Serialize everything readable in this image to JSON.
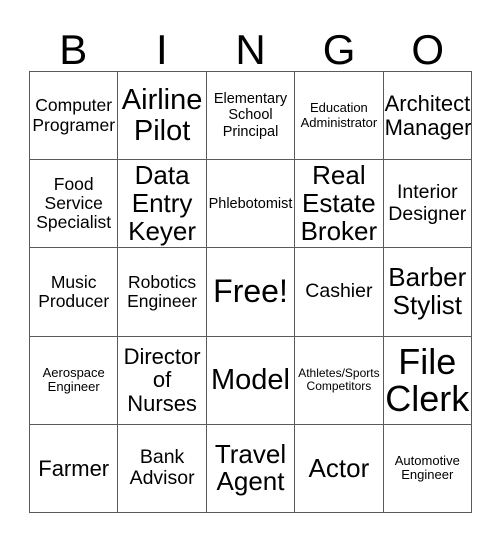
{
  "card": {
    "title": "BINGO",
    "header_letters": [
      "B",
      "I",
      "N",
      "G",
      "O"
    ],
    "columns": 5,
    "rows": 5,
    "free_space_label": "Free!",
    "free_space_position": {
      "row": 3,
      "column": 3
    },
    "colors": {
      "background": "#ffffff",
      "text": "#000000",
      "grid_line": "#5a5a5a"
    },
    "rows_data": [
      {
        "index": 1,
        "cells": [
          {
            "column": "B",
            "label": "Computer\nProgramer",
            "size": "fs-m"
          },
          {
            "column": "I",
            "label": "Airline\nPilot",
            "size": "fs-xxl"
          },
          {
            "column": "N",
            "label": "Elementary\nSchool\nPrincipal",
            "size": "fs-s"
          },
          {
            "column": "G",
            "label": "Education\nAdministrator",
            "size": "fs-xs"
          },
          {
            "column": "O",
            "label": "Architect\nManager",
            "size": "fs-l"
          }
        ]
      },
      {
        "index": 2,
        "cells": [
          {
            "column": "B",
            "label": "Food\nService\nSpecialist",
            "size": "fs-m"
          },
          {
            "column": "I",
            "label": "Data\nEntry\nKeyer",
            "size": "fs-xl"
          },
          {
            "column": "N",
            "label": "Phlebotomist",
            "size": "fs-s"
          },
          {
            "column": "G",
            "label": "Real\nEstate\nBroker",
            "size": "fs-xl"
          },
          {
            "column": "O",
            "label": "Interior\nDesigner",
            "size": "fs-ml"
          }
        ]
      },
      {
        "index": 3,
        "cells": [
          {
            "column": "B",
            "label": "Music\nProducer",
            "size": "fs-m"
          },
          {
            "column": "I",
            "label": "Robotics\nEngineer",
            "size": "fs-m"
          },
          {
            "column": "N",
            "label": "Free!",
            "size": "fs-3xl"
          },
          {
            "column": "G",
            "label": "Cashier",
            "size": "fs-ml"
          },
          {
            "column": "O",
            "label": "Barber\nStylist",
            "size": "fs-xl"
          }
        ]
      },
      {
        "index": 4,
        "cells": [
          {
            "column": "B",
            "label": "Aerospace\nEngineer",
            "size": "fs-xs"
          },
          {
            "column": "I",
            "label": "Director\nof\nNurses",
            "size": "fs-l"
          },
          {
            "column": "N",
            "label": "Model",
            "size": "fs-xxl"
          },
          {
            "column": "G",
            "label": "Athletes/Sports\nCompetitors",
            "size": "fs-xxs"
          },
          {
            "column": "O",
            "label": "File\nClerk",
            "size": "fs-4xl"
          }
        ]
      },
      {
        "index": 5,
        "cells": [
          {
            "column": "B",
            "label": "Farmer",
            "size": "fs-l"
          },
          {
            "column": "I",
            "label": "Bank\nAdvisor",
            "size": "fs-ml"
          },
          {
            "column": "N",
            "label": "Travel\nAgent",
            "size": "fs-xl"
          },
          {
            "column": "G",
            "label": "Actor",
            "size": "fs-xl"
          },
          {
            "column": "O",
            "label": "Automotive\nEngineer",
            "size": "fs-xs"
          }
        ]
      }
    ]
  }
}
